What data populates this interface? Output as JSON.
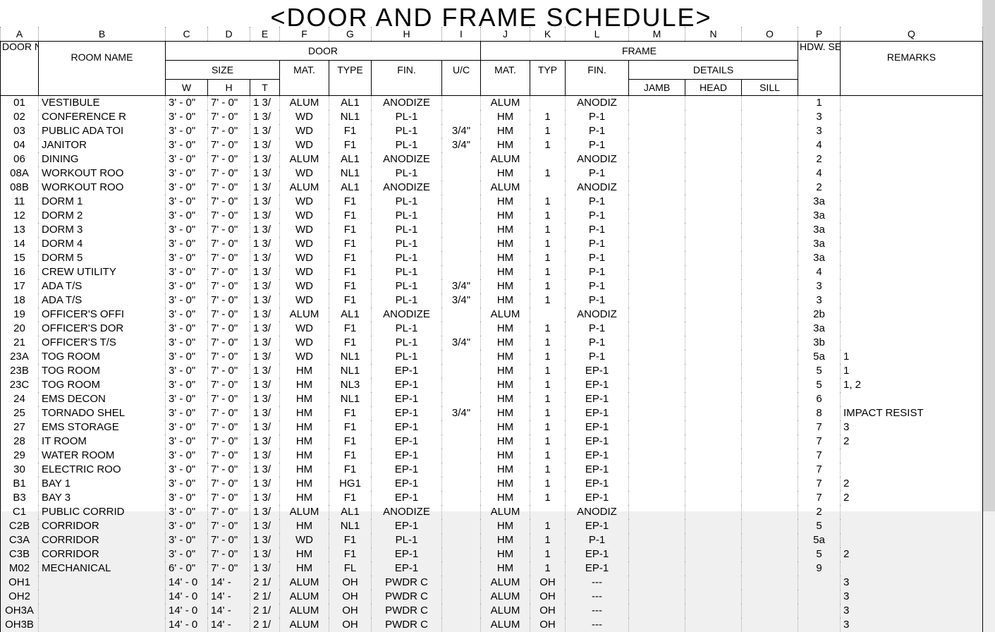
{
  "title": "<DOOR AND FRAME SCHEDULE>",
  "col_letters": [
    "A",
    "B",
    "C",
    "D",
    "E",
    "F",
    "G",
    "H",
    "I",
    "J",
    "K",
    "L",
    "M",
    "N",
    "O",
    "P",
    "Q"
  ],
  "headers": {
    "door_no": "DOOR No.",
    "room_name": "ROOM NAME",
    "door": "DOOR",
    "size": "SIZE",
    "w": "W",
    "h": "H",
    "t": "T",
    "mat": "MAT.",
    "type": "TYPE",
    "fin": "FIN.",
    "uc": "U/C",
    "frame": "FRAME",
    "typ": "TYP",
    "details": "DETAILS",
    "jamb": "JAMB",
    "head": "HEAD",
    "sill": "SILL",
    "hdw_set": "HDW. SET",
    "remarks": "REMARKS"
  },
  "rows": [
    {
      "no": "01",
      "room": "VESTIBULE",
      "w": "3' - 0\"",
      "h": "7' - 0\"",
      "t": "1 3/",
      "dmat": "ALUM",
      "dtype": "AL1",
      "dfin": "ANODIZE",
      "uc": "",
      "fmat": "ALUM",
      "ftyp": "",
      "ffin": "ANODIZ",
      "jamb": "",
      "head": "",
      "sill": "",
      "hdw": "1",
      "rem": ""
    },
    {
      "no": "02",
      "room": "CONFERENCE R",
      "w": "3' - 0\"",
      "h": "7' - 0\"",
      "t": "1 3/",
      "dmat": "WD",
      "dtype": "NL1",
      "dfin": "PL-1",
      "uc": "",
      "fmat": "HM",
      "ftyp": "1",
      "ffin": "P-1",
      "jamb": "",
      "head": "",
      "sill": "",
      "hdw": "3",
      "rem": ""
    },
    {
      "no": "03",
      "room": "PUBLIC ADA TOI",
      "w": "3' - 0\"",
      "h": "7' - 0\"",
      "t": "1 3/",
      "dmat": "WD",
      "dtype": "F1",
      "dfin": "PL-1",
      "uc": "3/4\"",
      "fmat": "HM",
      "ftyp": "1",
      "ffin": "P-1",
      "jamb": "",
      "head": "",
      "sill": "",
      "hdw": "3",
      "rem": ""
    },
    {
      "no": "04",
      "room": "JANITOR",
      "w": "3' - 0\"",
      "h": "7' - 0\"",
      "t": "1 3/",
      "dmat": "WD",
      "dtype": "F1",
      "dfin": "PL-1",
      "uc": "3/4\"",
      "fmat": "HM",
      "ftyp": "1",
      "ffin": "P-1",
      "jamb": "",
      "head": "",
      "sill": "",
      "hdw": "4",
      "rem": ""
    },
    {
      "no": "06",
      "room": "DINING",
      "w": "3' - 0\"",
      "h": "7' - 0\"",
      "t": "1 3/",
      "dmat": "ALUM",
      "dtype": "AL1",
      "dfin": "ANODIZE",
      "uc": "",
      "fmat": "ALUM",
      "ftyp": "",
      "ffin": "ANODIZ",
      "jamb": "",
      "head": "",
      "sill": "",
      "hdw": "2",
      "rem": ""
    },
    {
      "no": "08A",
      "room": "WORKOUT ROO",
      "w": "3' - 0\"",
      "h": "7' - 0\"",
      "t": "1 3/",
      "dmat": "WD",
      "dtype": "NL1",
      "dfin": "PL-1",
      "uc": "",
      "fmat": "HM",
      "ftyp": "1",
      "ffin": "P-1",
      "jamb": "",
      "head": "",
      "sill": "",
      "hdw": "4",
      "rem": ""
    },
    {
      "no": "08B",
      "room": "WORKOUT ROO",
      "w": "3' - 0\"",
      "h": "7' - 0\"",
      "t": "1 3/",
      "dmat": "ALUM",
      "dtype": "AL1",
      "dfin": "ANODIZE",
      "uc": "",
      "fmat": "ALUM",
      "ftyp": "",
      "ffin": "ANODIZ",
      "jamb": "",
      "head": "",
      "sill": "",
      "hdw": "2",
      "rem": ""
    },
    {
      "no": "11",
      "room": "DORM 1",
      "w": "3' - 0\"",
      "h": "7' - 0\"",
      "t": "1 3/",
      "dmat": "WD",
      "dtype": "F1",
      "dfin": "PL-1",
      "uc": "",
      "fmat": "HM",
      "ftyp": "1",
      "ffin": "P-1",
      "jamb": "",
      "head": "",
      "sill": "",
      "hdw": "3a",
      "rem": ""
    },
    {
      "no": "12",
      "room": "DORM 2",
      "w": "3' - 0\"",
      "h": "7' - 0\"",
      "t": "1 3/",
      "dmat": "WD",
      "dtype": "F1",
      "dfin": "PL-1",
      "uc": "",
      "fmat": "HM",
      "ftyp": "1",
      "ffin": "P-1",
      "jamb": "",
      "head": "",
      "sill": "",
      "hdw": "3a",
      "rem": ""
    },
    {
      "no": "13",
      "room": "DORM 3",
      "w": "3' - 0\"",
      "h": "7' - 0\"",
      "t": "1 3/",
      "dmat": "WD",
      "dtype": "F1",
      "dfin": "PL-1",
      "uc": "",
      "fmat": "HM",
      "ftyp": "1",
      "ffin": "P-1",
      "jamb": "",
      "head": "",
      "sill": "",
      "hdw": "3a",
      "rem": ""
    },
    {
      "no": "14",
      "room": "DORM 4",
      "w": "3' - 0\"",
      "h": "7' - 0\"",
      "t": "1 3/",
      "dmat": "WD",
      "dtype": "F1",
      "dfin": "PL-1",
      "uc": "",
      "fmat": "HM",
      "ftyp": "1",
      "ffin": "P-1",
      "jamb": "",
      "head": "",
      "sill": "",
      "hdw": "3a",
      "rem": ""
    },
    {
      "no": "15",
      "room": "DORM 5",
      "w": "3' - 0\"",
      "h": "7' - 0\"",
      "t": "1 3/",
      "dmat": "WD",
      "dtype": "F1",
      "dfin": "PL-1",
      "uc": "",
      "fmat": "HM",
      "ftyp": "1",
      "ffin": "P-1",
      "jamb": "",
      "head": "",
      "sill": "",
      "hdw": "3a",
      "rem": ""
    },
    {
      "no": "16",
      "room": "CREW UTILITY",
      "w": "3' - 0\"",
      "h": "7' - 0\"",
      "t": "1 3/",
      "dmat": "WD",
      "dtype": "F1",
      "dfin": "PL-1",
      "uc": "",
      "fmat": "HM",
      "ftyp": "1",
      "ffin": "P-1",
      "jamb": "",
      "head": "",
      "sill": "",
      "hdw": "4",
      "rem": ""
    },
    {
      "no": "17",
      "room": "ADA T/S",
      "w": "3' - 0\"",
      "h": "7' - 0\"",
      "t": "1 3/",
      "dmat": "WD",
      "dtype": "F1",
      "dfin": "PL-1",
      "uc": "3/4\"",
      "fmat": "HM",
      "ftyp": "1",
      "ffin": "P-1",
      "jamb": "",
      "head": "",
      "sill": "",
      "hdw": "3",
      "rem": ""
    },
    {
      "no": "18",
      "room": "ADA T/S",
      "w": "3' - 0\"",
      "h": "7' - 0\"",
      "t": "1 3/",
      "dmat": "WD",
      "dtype": "F1",
      "dfin": "PL-1",
      "uc": "3/4\"",
      "fmat": "HM",
      "ftyp": "1",
      "ffin": "P-1",
      "jamb": "",
      "head": "",
      "sill": "",
      "hdw": "3",
      "rem": ""
    },
    {
      "no": "19",
      "room": "OFFICER'S OFFI",
      "w": "3' - 0\"",
      "h": "7' - 0\"",
      "t": "1 3/",
      "dmat": "ALUM",
      "dtype": "AL1",
      "dfin": "ANODIZE",
      "uc": "",
      "fmat": "ALUM",
      "ftyp": "",
      "ffin": "ANODIZ",
      "jamb": "",
      "head": "",
      "sill": "",
      "hdw": "2b",
      "rem": ""
    },
    {
      "no": "20",
      "room": "OFFICER'S DOR",
      "w": "3' - 0\"",
      "h": "7' - 0\"",
      "t": "1 3/",
      "dmat": "WD",
      "dtype": "F1",
      "dfin": "PL-1",
      "uc": "",
      "fmat": "HM",
      "ftyp": "1",
      "ffin": "P-1",
      "jamb": "",
      "head": "",
      "sill": "",
      "hdw": "3a",
      "rem": ""
    },
    {
      "no": "21",
      "room": "OFFICER'S T/S",
      "w": "3' - 0\"",
      "h": "7' - 0\"",
      "t": "1 3/",
      "dmat": "WD",
      "dtype": "F1",
      "dfin": "PL-1",
      "uc": "3/4\"",
      "fmat": "HM",
      "ftyp": "1",
      "ffin": "P-1",
      "jamb": "",
      "head": "",
      "sill": "",
      "hdw": "3b",
      "rem": ""
    },
    {
      "no": "23A",
      "room": "TOG ROOM",
      "w": "3' - 0\"",
      "h": "7' - 0\"",
      "t": "1 3/",
      "dmat": "WD",
      "dtype": "NL1",
      "dfin": "PL-1",
      "uc": "",
      "fmat": "HM",
      "ftyp": "1",
      "ffin": "P-1",
      "jamb": "",
      "head": "",
      "sill": "",
      "hdw": "5a",
      "rem": "1"
    },
    {
      "no": "23B",
      "room": "TOG ROOM",
      "w": "3' - 0\"",
      "h": "7' - 0\"",
      "t": "1 3/",
      "dmat": "HM",
      "dtype": "NL1",
      "dfin": "EP-1",
      "uc": "",
      "fmat": "HM",
      "ftyp": "1",
      "ffin": "EP-1",
      "jamb": "",
      "head": "",
      "sill": "",
      "hdw": "5",
      "rem": "1"
    },
    {
      "no": "23C",
      "room": "TOG ROOM",
      "w": "3' - 0\"",
      "h": "7' - 0\"",
      "t": "1 3/",
      "dmat": "HM",
      "dtype": "NL3",
      "dfin": "EP-1",
      "uc": "",
      "fmat": "HM",
      "ftyp": "1",
      "ffin": "EP-1",
      "jamb": "",
      "head": "",
      "sill": "",
      "hdw": "5",
      "rem": "1, 2"
    },
    {
      "no": "24",
      "room": "EMS DECON",
      "w": "3' - 0\"",
      "h": "7' - 0\"",
      "t": "1 3/",
      "dmat": "HM",
      "dtype": "NL1",
      "dfin": "EP-1",
      "uc": "",
      "fmat": "HM",
      "ftyp": "1",
      "ffin": "EP-1",
      "jamb": "",
      "head": "",
      "sill": "",
      "hdw": "6",
      "rem": ""
    },
    {
      "no": "25",
      "room": "TORNADO SHEL",
      "w": "3' - 0\"",
      "h": "7' - 0\"",
      "t": "1 3/",
      "dmat": "HM",
      "dtype": "F1",
      "dfin": "EP-1",
      "uc": "3/4\"",
      "fmat": "HM",
      "ftyp": "1",
      "ffin": "EP-1",
      "jamb": "",
      "head": "",
      "sill": "",
      "hdw": "8",
      "rem": "IMPACT RESIST"
    },
    {
      "no": "27",
      "room": "EMS STORAGE",
      "w": "3' - 0\"",
      "h": "7' - 0\"",
      "t": "1 3/",
      "dmat": "HM",
      "dtype": "F1",
      "dfin": "EP-1",
      "uc": "",
      "fmat": "HM",
      "ftyp": "1",
      "ffin": "EP-1",
      "jamb": "",
      "head": "",
      "sill": "",
      "hdw": "7",
      "rem": "3"
    },
    {
      "no": "28",
      "room": "IT ROOM",
      "w": "3' - 0\"",
      "h": "7' - 0\"",
      "t": "1 3/",
      "dmat": "HM",
      "dtype": "F1",
      "dfin": "EP-1",
      "uc": "",
      "fmat": "HM",
      "ftyp": "1",
      "ffin": "EP-1",
      "jamb": "",
      "head": "",
      "sill": "",
      "hdw": "7",
      "rem": "2"
    },
    {
      "no": "29",
      "room": "WATER ROOM",
      "w": "3' - 0\"",
      "h": "7' - 0\"",
      "t": "1 3/",
      "dmat": "HM",
      "dtype": "F1",
      "dfin": "EP-1",
      "uc": "",
      "fmat": "HM",
      "ftyp": "1",
      "ffin": "EP-1",
      "jamb": "",
      "head": "",
      "sill": "",
      "hdw": "7",
      "rem": ""
    },
    {
      "no": "30",
      "room": "ELECTRIC ROO",
      "w": "3' - 0\"",
      "h": "7' - 0\"",
      "t": "1 3/",
      "dmat": "HM",
      "dtype": "F1",
      "dfin": "EP-1",
      "uc": "",
      "fmat": "HM",
      "ftyp": "1",
      "ffin": "EP-1",
      "jamb": "",
      "head": "",
      "sill": "",
      "hdw": "7",
      "rem": ""
    },
    {
      "no": "B1",
      "room": "BAY 1",
      "w": "3' - 0\"",
      "h": "7' - 0\"",
      "t": "1 3/",
      "dmat": "HM",
      "dtype": "HG1",
      "dfin": "EP-1",
      "uc": "",
      "fmat": "HM",
      "ftyp": "1",
      "ffin": "EP-1",
      "jamb": "",
      "head": "",
      "sill": "",
      "hdw": "7",
      "rem": "2"
    },
    {
      "no": "B3",
      "room": "BAY 3",
      "w": "3' - 0\"",
      "h": "7' - 0\"",
      "t": "1 3/",
      "dmat": "HM",
      "dtype": "F1",
      "dfin": "EP-1",
      "uc": "",
      "fmat": "HM",
      "ftyp": "1",
      "ffin": "EP-1",
      "jamb": "",
      "head": "",
      "sill": "",
      "hdw": "7",
      "rem": "2"
    },
    {
      "no": "C1",
      "room": "PUBLIC CORRID",
      "w": "3' - 0\"",
      "h": "7' - 0\"",
      "t": "1 3/",
      "dmat": "ALUM",
      "dtype": "AL1",
      "dfin": "ANODIZE",
      "uc": "",
      "fmat": "ALUM",
      "ftyp": "",
      "ffin": "ANODIZ",
      "jamb": "",
      "head": "",
      "sill": "",
      "hdw": "2",
      "rem": ""
    },
    {
      "no": "C2B",
      "room": "CORRIDOR",
      "w": "3' - 0\"",
      "h": "7' - 0\"",
      "t": "1 3/",
      "dmat": "HM",
      "dtype": "NL1",
      "dfin": "EP-1",
      "uc": "",
      "fmat": "HM",
      "ftyp": "1",
      "ffin": "EP-1",
      "jamb": "",
      "head": "",
      "sill": "",
      "hdw": "5",
      "rem": ""
    },
    {
      "no": "C3A",
      "room": "CORRIDOR",
      "w": "3' - 0\"",
      "h": "7' - 0\"",
      "t": "1 3/",
      "dmat": "WD",
      "dtype": "F1",
      "dfin": "PL-1",
      "uc": "",
      "fmat": "HM",
      "ftyp": "1",
      "ffin": "P-1",
      "jamb": "",
      "head": "",
      "sill": "",
      "hdw": "5a",
      "rem": ""
    },
    {
      "no": "C3B",
      "room": "CORRIDOR",
      "w": "3' - 0\"",
      "h": "7' - 0\"",
      "t": "1 3/",
      "dmat": "HM",
      "dtype": "F1",
      "dfin": "EP-1",
      "uc": "",
      "fmat": "HM",
      "ftyp": "1",
      "ffin": "EP-1",
      "jamb": "",
      "head": "",
      "sill": "",
      "hdw": "5",
      "rem": "2"
    },
    {
      "no": "M02",
      "room": "MECHANICAL",
      "w": "6' - 0\"",
      "h": "7' - 0\"",
      "t": "1 3/",
      "dmat": "HM",
      "dtype": "FL",
      "dfin": "EP-1",
      "uc": "",
      "fmat": "HM",
      "ftyp": "1",
      "ffin": "EP-1",
      "jamb": "",
      "head": "",
      "sill": "",
      "hdw": "9",
      "rem": ""
    },
    {
      "no": "OH1",
      "room": "",
      "w": "14' - 0",
      "h": "14' -",
      "t": "2 1/",
      "dmat": "ALUM",
      "dtype": "OH",
      "dfin": "PWDR C",
      "uc": "",
      "fmat": "ALUM",
      "ftyp": "OH",
      "ffin": "---",
      "jamb": "",
      "head": "",
      "sill": "",
      "hdw": "",
      "rem": "3"
    },
    {
      "no": "OH2",
      "room": "",
      "w": "14' - 0",
      "h": "14' -",
      "t": "2 1/",
      "dmat": "ALUM",
      "dtype": "OH",
      "dfin": "PWDR C",
      "uc": "",
      "fmat": "ALUM",
      "ftyp": "OH",
      "ffin": "---",
      "jamb": "",
      "head": "",
      "sill": "",
      "hdw": "",
      "rem": "3"
    },
    {
      "no": "OH3A",
      "room": "",
      "w": "14' - 0",
      "h": "14' -",
      "t": "2 1/",
      "dmat": "ALUM",
      "dtype": "OH",
      "dfin": "PWDR C",
      "uc": "",
      "fmat": "ALUM",
      "ftyp": "OH",
      "ffin": "---",
      "jamb": "",
      "head": "",
      "sill": "",
      "hdw": "",
      "rem": "3"
    },
    {
      "no": "OH3B",
      "room": "",
      "w": "14' - 0",
      "h": "14' -",
      "t": "2 1/",
      "dmat": "ALUM",
      "dtype": "OH",
      "dfin": "PWDR C",
      "uc": "",
      "fmat": "ALUM",
      "ftyp": "OH",
      "ffin": "---",
      "jamb": "",
      "head": "",
      "sill": "",
      "hdw": "",
      "rem": "3"
    }
  ]
}
